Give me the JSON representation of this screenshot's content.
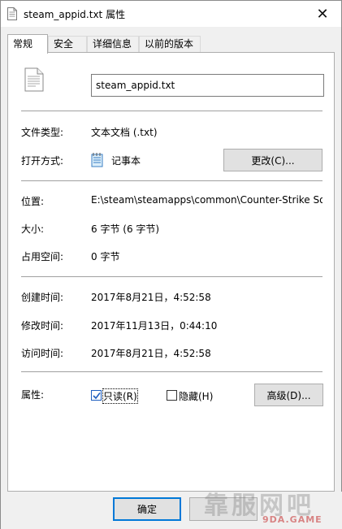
{
  "window": {
    "title": "steam_appid.txt 属性",
    "close_glyph": "✕"
  },
  "tabs": [
    {
      "label": "常规"
    },
    {
      "label": "安全"
    },
    {
      "label": "详细信息"
    },
    {
      "label": "以前的版本"
    }
  ],
  "general": {
    "filename": "steam_appid.txt",
    "file_type_label": "文件类型:",
    "file_type_value": "文本文档 (.txt)",
    "opens_with_label": "打开方式:",
    "opens_with_value": "记事本",
    "change_button": "更改(C)...",
    "location_label": "位置:",
    "location_value": "E:\\steam\\steamapps\\common\\Counter-Strike Sou",
    "size_label": "大小:",
    "size_value": "6 字节 (6 字节)",
    "size_on_disk_label": "占用空间:",
    "size_on_disk_value": "0 字节",
    "created_label": "创建时间:",
    "created_value": "2017年8月21日，4:52:58",
    "modified_label": "修改时间:",
    "modified_value": "2017年11月13日，0:44:10",
    "accessed_label": "访问时间:",
    "accessed_value": "2017年8月21日，4:52:58",
    "attributes_label": "属性:",
    "readonly_label": "只读(R)",
    "readonly_checked": true,
    "hidden_label": "隐藏(H)",
    "hidden_checked": false,
    "advanced_button": "高级(D)..."
  },
  "footer": {
    "ok_button": "确定",
    "cancel_button": ""
  },
  "watermark": {
    "text": "靠服网吧",
    "sub": "9DA.GAME"
  },
  "colors": {
    "panel_bg": "#ffffff",
    "window_bg": "#f0f0f0",
    "button_bg": "#e1e1e1",
    "ok_border": "#0078d7",
    "check_color": "#1f5fbf"
  }
}
